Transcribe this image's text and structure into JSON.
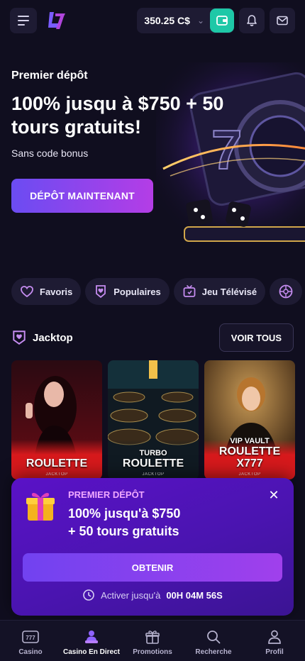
{
  "header": {
    "balance": "350.25 C$"
  },
  "hero": {
    "eyebrow": "Premier dépôt",
    "title": "100% jusqu à $750 + 50 tours gratuits!",
    "subtitle": "Sans code bonus",
    "cta": "DÉPÔT MAINTENANT"
  },
  "chips": [
    {
      "label": "Favoris",
      "icon": "heart-icon"
    },
    {
      "label": "Populaires",
      "icon": "heart-shield-icon"
    },
    {
      "label": "Jeu Télévisé",
      "icon": "tv-icon"
    },
    {
      "label": "",
      "icon": "roulette-icon"
    }
  ],
  "section": {
    "title": "Jacktop",
    "see_all": "VOIR TOUS"
  },
  "games": [
    {
      "kicker": "",
      "title": "ROULETTE",
      "provider": "JACKTOP"
    },
    {
      "kicker": "TURBO",
      "title": "ROULETTE",
      "provider": "JACKTOP"
    },
    {
      "kicker": "VIP VAULT",
      "title": "ROULETTE X777",
      "provider": "JACKTOP"
    }
  ],
  "popup": {
    "eyebrow": "PREMIER DÉPÔT",
    "title_line1": "100% jusqu'à $750",
    "title_line2": "+ 50 tours gratuits",
    "cta": "OBTENIR",
    "timer_label": "Activer jusqu'à",
    "timer_value": "00H 04M 56S"
  },
  "bottom_nav": [
    {
      "label": "Casino",
      "icon": "casino-icon",
      "active": false
    },
    {
      "label": "Casino En Direct",
      "icon": "live-dealer-icon",
      "active": true
    },
    {
      "label": "Promotions",
      "icon": "gift-icon",
      "active": false
    },
    {
      "label": "Recherche",
      "icon": "search-icon",
      "active": false
    },
    {
      "label": "Profil",
      "icon": "profile-icon",
      "active": false
    }
  ],
  "colors": {
    "background": "#100e1f",
    "accent_purple": "#6b4cf2",
    "accent_magenta": "#b43de6",
    "wallet_teal": "#1ec8a7",
    "game_red": "#d7191c"
  }
}
